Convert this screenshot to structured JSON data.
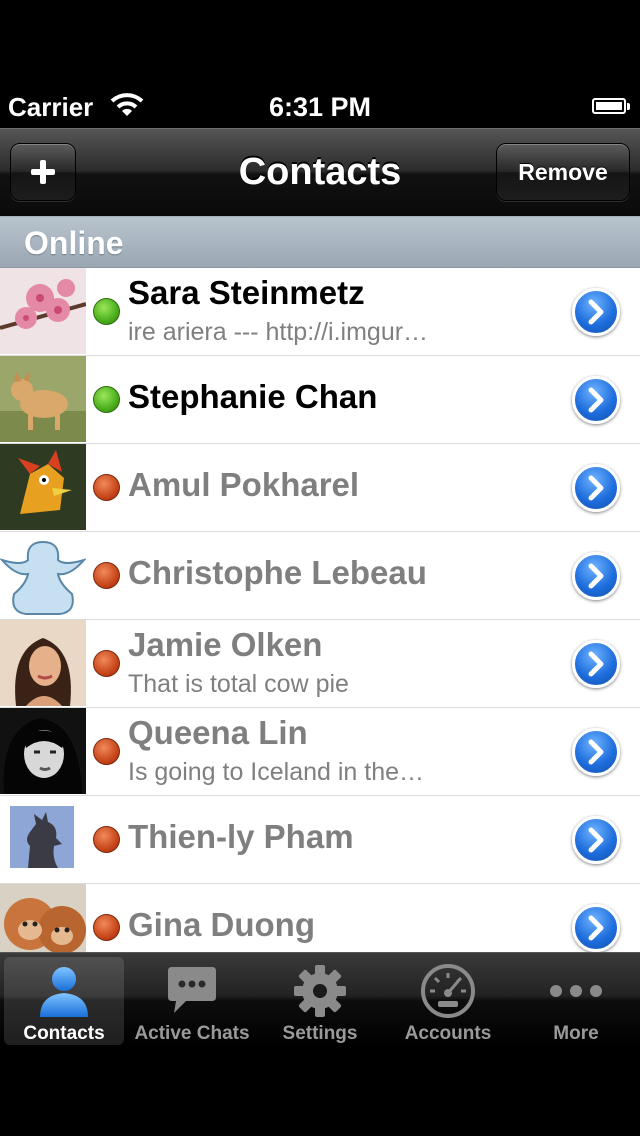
{
  "status_bar": {
    "carrier": "Carrier",
    "time": "6:31 PM"
  },
  "nav": {
    "title": "Contacts",
    "remove_label": "Remove"
  },
  "section": {
    "title": "Online"
  },
  "contacts": [
    {
      "name": "Sara Steinmetz",
      "status": "ire ariera --- http://i.imgur…",
      "presence": "online"
    },
    {
      "name": "Stephanie Chan",
      "status": "",
      "presence": "online"
    },
    {
      "name": "Amul Pokharel",
      "status": "",
      "presence": "away"
    },
    {
      "name": "Christophe Lebeau",
      "status": "",
      "presence": "away"
    },
    {
      "name": "Jamie Olken",
      "status": "That is total cow pie",
      "presence": "away"
    },
    {
      "name": "Queena Lin",
      "status": "Is going to Iceland in the…",
      "presence": "away"
    },
    {
      "name": "Thien-ly Pham",
      "status": "",
      "presence": "away"
    },
    {
      "name": "Gina Duong",
      "status": "",
      "presence": "away"
    }
  ],
  "tabs": [
    {
      "label": "Contacts",
      "icon": "person-icon",
      "active": true
    },
    {
      "label": "Active Chats",
      "icon": "chat-bubble-icon",
      "active": false
    },
    {
      "label": "Settings",
      "icon": "gear-icon",
      "active": false
    },
    {
      "label": "Accounts",
      "icon": "speedometer-icon",
      "active": false
    },
    {
      "label": "More",
      "icon": "more-dots-icon",
      "active": false
    }
  ],
  "colors": {
    "online": "#4aae1b",
    "away": "#c9461b",
    "accent": "#1f6fde"
  }
}
